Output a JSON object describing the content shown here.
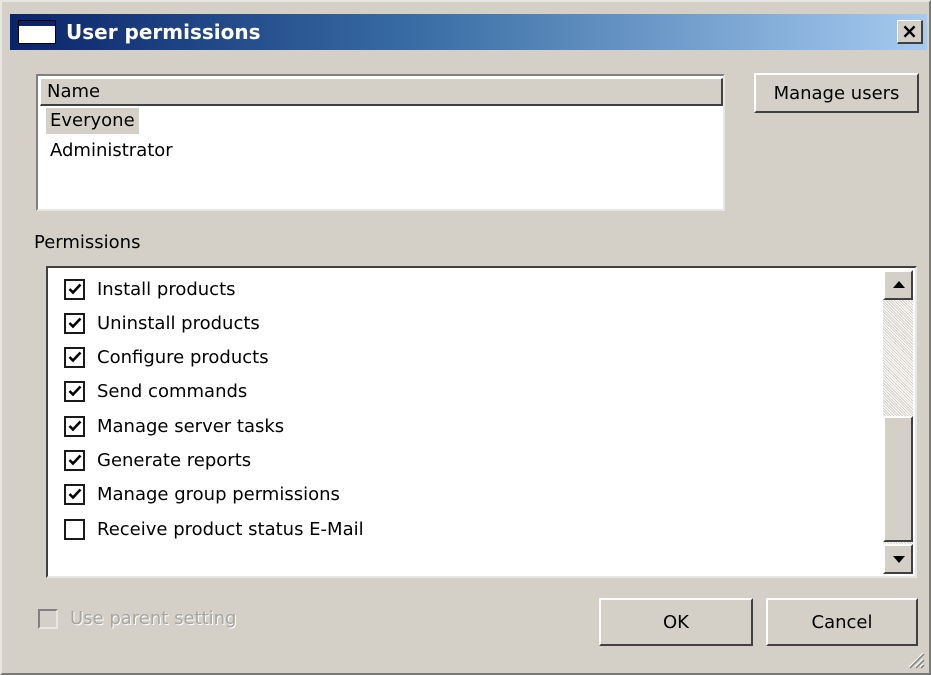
{
  "window": {
    "title": "User permissions",
    "close_symbol": "×",
    "icon": "window-icon"
  },
  "users": {
    "column_header": "Name",
    "items": [
      {
        "label": "Everyone",
        "selected": true
      },
      {
        "label": "Administrator",
        "selected": false
      }
    ],
    "manage_button": "Manage users"
  },
  "permissions": {
    "label": "Permissions",
    "items": [
      {
        "label": "Install products",
        "checked": true
      },
      {
        "label": "Uninstall products",
        "checked": true
      },
      {
        "label": "Configure products",
        "checked": true
      },
      {
        "label": "Send commands",
        "checked": true
      },
      {
        "label": "Manage server tasks",
        "checked": true
      },
      {
        "label": "Generate reports",
        "checked": true
      },
      {
        "label": "Manage group permissions",
        "checked": true
      },
      {
        "label": "Receive product status E-Mail",
        "checked": false
      }
    ]
  },
  "footer": {
    "parent_setting_label": "Use parent setting",
    "parent_setting_checked": false,
    "parent_setting_enabled": false,
    "ok_label": "OK",
    "cancel_label": "Cancel"
  },
  "colors": {
    "titlebar_start": "#0a246a",
    "titlebar_end": "#a6caf0",
    "face": "#d4d0c8"
  }
}
